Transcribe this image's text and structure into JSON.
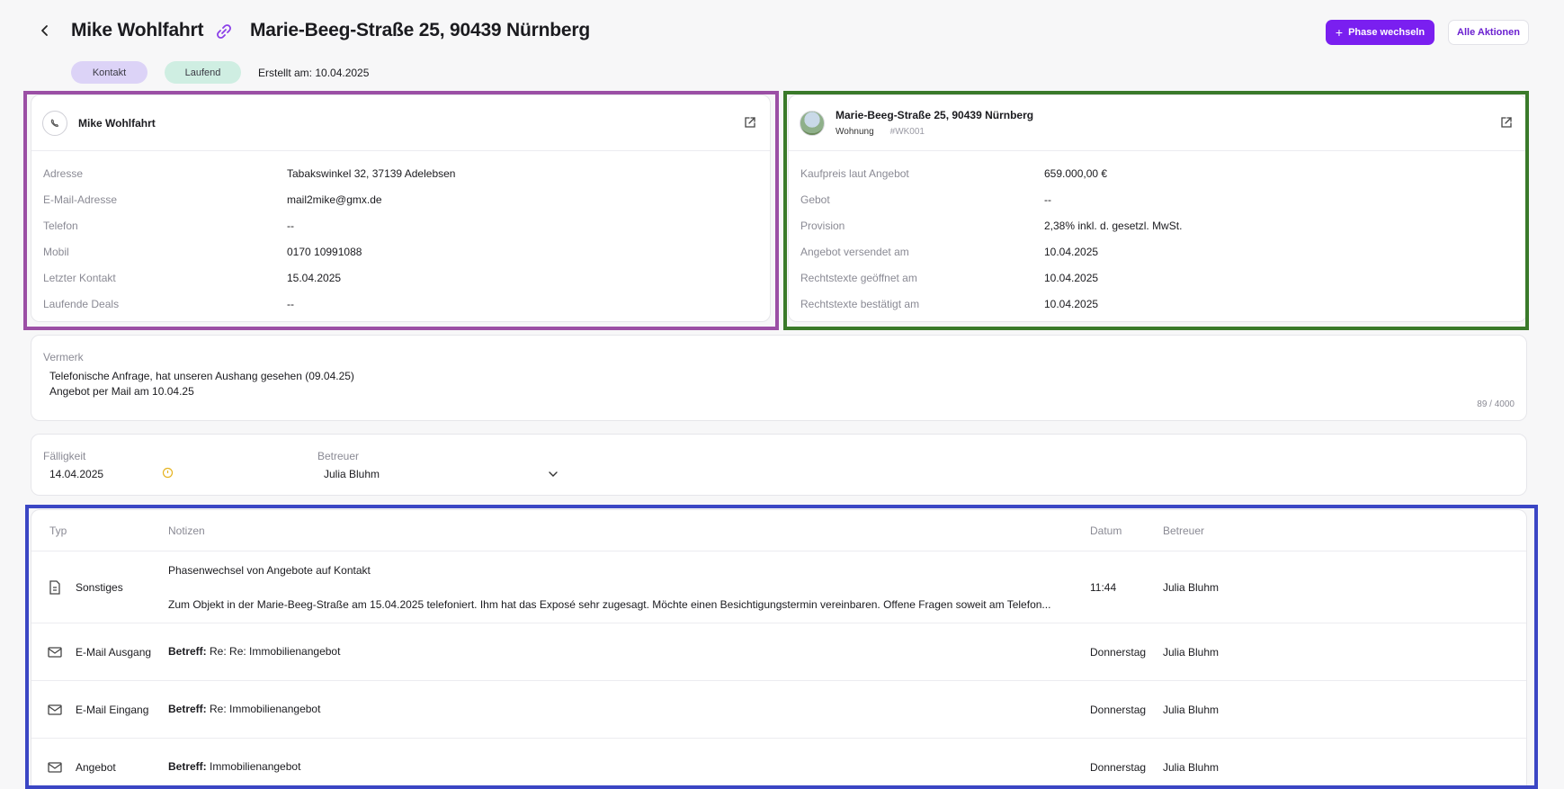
{
  "header": {
    "contact_name": "Mike Wohlfahrt",
    "property_address": "Marie-Beeg-Straße 25, 90439 Nürnberg",
    "primary_button": "Phase wechseln",
    "secondary_button": "Alle Aktionen",
    "pill_contact": "Kontakt",
    "pill_status": "Laufend",
    "created": "Erstellt am: 10.04.2025"
  },
  "colors": {
    "accent": "#7a1ff0",
    "frame_contact": "#9b4fa5",
    "frame_property": "#3a7a2a",
    "frame_table": "#3b46c4"
  },
  "contact_card": {
    "name": "Mike Wohlfahrt",
    "rows": [
      {
        "label": "Adresse",
        "value": "Tabakswinkel 32, 37139 Adelebsen"
      },
      {
        "label": "E-Mail-Adresse",
        "value": "mail2mike@gmx.de"
      },
      {
        "label": "Telefon",
        "value": "--"
      },
      {
        "label": "Mobil",
        "value": "0170 10991088"
      },
      {
        "label": "Letzter Kontakt",
        "value": "15.04.2025"
      },
      {
        "label": "Laufende Deals",
        "value": "--"
      }
    ]
  },
  "property_card": {
    "title": "Marie-Beeg-Straße 25, 90439 Nürnberg",
    "type": "Wohnung",
    "code": "#WK001",
    "rows": [
      {
        "label": "Kaufpreis laut Angebot",
        "value": "659.000,00 €"
      },
      {
        "label": "Gebot",
        "value": "--"
      },
      {
        "label": "Provision",
        "value": "2,38% inkl. d. gesetzl. MwSt."
      },
      {
        "label": "Angebot versendet am",
        "value": "10.04.2025"
      },
      {
        "label": "Rechtstexte geöffnet am",
        "value": "10.04.2025"
      },
      {
        "label": "Rechtstexte bestätigt am",
        "value": "10.04.2025"
      }
    ]
  },
  "note": {
    "label": "Vermerk",
    "line1": "Telefonische Anfrage, hat unseren Aushang gesehen (09.04.25)",
    "line2": "Angebot per Mail am 10.04.25",
    "counter": "89 / 4000"
  },
  "due": {
    "label": "Fälligkeit",
    "value": "14.04.2025",
    "assignee_label": "Betreuer",
    "assignee_value": "Julia Bluhm"
  },
  "table": {
    "headers": {
      "type": "Typ",
      "notes": "Notizen",
      "date": "Datum",
      "assignee": "Betreuer"
    },
    "rows": [
      {
        "icon": "document-icon",
        "type": "Sonstiges",
        "line1": "Phasenwechsel von Angebote auf Kontakt",
        "line2": "Zum Objekt in der Marie-Beeg-Straße am 15.04.2025 telefoniert. Ihm hat das Exposé sehr zugesagt. Möchte einen Besichtigungstermin vereinbaren. Offene Fragen soweit am Telefon...",
        "date": "11:44",
        "assignee": "Julia Bluhm"
      },
      {
        "icon": "mail-icon",
        "type": "E-Mail Ausgang",
        "subject_label": "Betreff:",
        "subject": "Re: Re: Immobilienangebot",
        "date": "Donnerstag",
        "assignee": "Julia Bluhm"
      },
      {
        "icon": "mail-icon",
        "type": "E-Mail Eingang",
        "subject_label": "Betreff:",
        "subject": "Re: Immobilienangebot",
        "date": "Donnerstag",
        "assignee": "Julia Bluhm"
      },
      {
        "icon": "mail-icon",
        "type": "Angebot",
        "subject_label": "Betreff:",
        "subject": "Immobilienangebot",
        "date": "Donnerstag",
        "assignee": "Julia Bluhm"
      }
    ]
  }
}
